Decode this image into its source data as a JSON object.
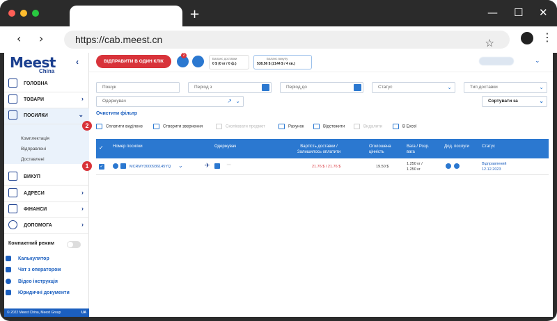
{
  "browser": {
    "url": "https://cab.meest.cn",
    "new_tab": "+",
    "minimize": "—",
    "maximize": "☐",
    "close": "✕"
  },
  "sidebar": {
    "logo": "Meest",
    "logo_sub": "China",
    "items": [
      {
        "label": "ГОЛОВНА"
      },
      {
        "label": "ТОВАРИ"
      },
      {
        "label": "ПОСИЛКИ"
      },
      {
        "label": "ВИКУП"
      },
      {
        "label": "АДРЕСИ"
      },
      {
        "label": "ФІНАНСИ"
      },
      {
        "label": "ДОПОМОГА"
      }
    ],
    "sub_items": [
      "Комплектація",
      "Відправлені",
      "Доставлені"
    ],
    "compact_mode": "Компактний режим",
    "links": [
      "Калькулятор",
      "Чат з оператором",
      "Відео інструкція",
      "Юридичні документи"
    ],
    "footer": "© 2022 Meest China, Meest Group",
    "lang": "UA"
  },
  "topbar": {
    "send_button": "ВІДПРАВИТИ В ОДИН КЛІК",
    "notifications_count": "2",
    "delivery_balance_title": "Баланс доставки",
    "delivery_balance_value": "0 $ (0 кг / 0 ф.)",
    "buyout_balance_title": "Баланс викупу",
    "buyout_balance_value": "538.56 $ (2144 $ / 4 кв.)"
  },
  "filters": {
    "search_placeholder": "Пошук",
    "period_from": "Період з",
    "period_to": "Період до",
    "status": "Статус",
    "delivery_type": "Тип доставки",
    "recipient": "Одержувач",
    "sort": "Сортувати за",
    "clear": "Очистити фільтр"
  },
  "actions": [
    {
      "label": "Сплатити виділене",
      "enabled": true
    },
    {
      "label": "Створити звернення",
      "enabled": true
    },
    {
      "label": "Скопіювати предмет",
      "enabled": false
    },
    {
      "label": "Рахунок",
      "enabled": true
    },
    {
      "label": "Відстежити",
      "enabled": true
    },
    {
      "label": "Видалити",
      "enabled": false
    },
    {
      "label": "В Excel",
      "enabled": true
    }
  ],
  "table": {
    "columns": [
      "Номер посилки",
      "Одержувач",
      "Вартість доставки / Залишилось оплатити",
      "Оголошена цінність",
      "Вага / Розр. вага",
      "Дод. послуги",
      "Статус"
    ],
    "rows": [
      {
        "number": "MCRMY3000936145YQ",
        "recipient": "—",
        "delivery_cost": "21.76 $ / 21.76 $",
        "declared_value": "19.50 $",
        "weight": "1.250 кг /",
        "weight2": "1.250 кг",
        "status": "Відправлений",
        "status_date": "12.12.2023"
      }
    ]
  },
  "steps": [
    "1",
    "2"
  ],
  "colors": {
    "accent": "#2b78d0",
    "brand": "#1b3f8f",
    "danger": "#d8333a"
  }
}
